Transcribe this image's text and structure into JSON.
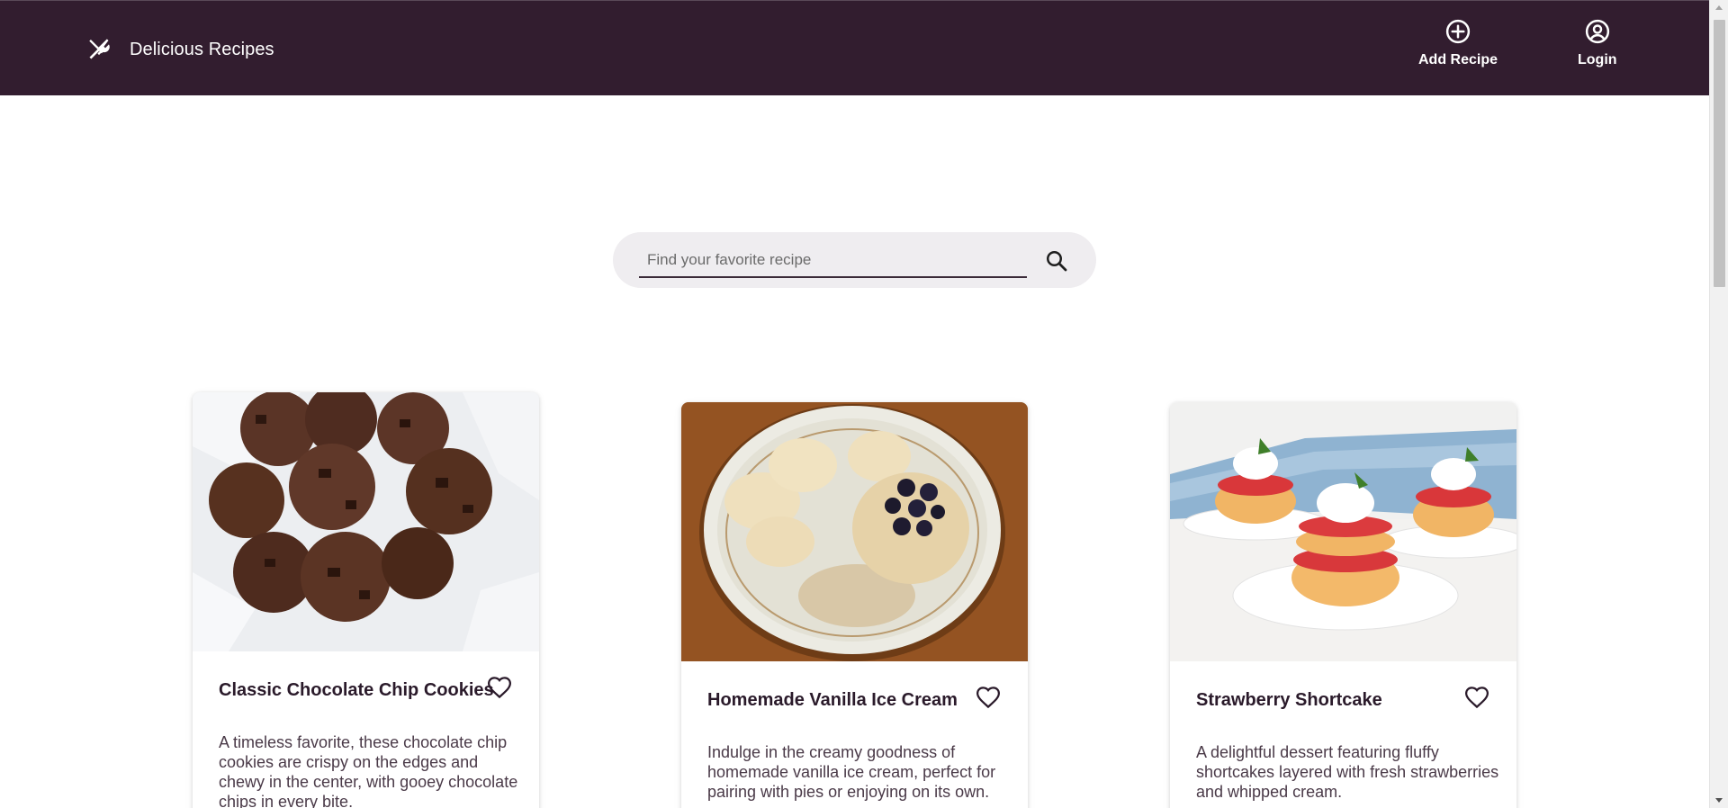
{
  "header": {
    "title": "Delicious Recipes",
    "actions": [
      {
        "label": "Add Recipe",
        "icon": "add-circle-icon"
      },
      {
        "label": "Login",
        "icon": "account-circle-icon"
      }
    ]
  },
  "search": {
    "placeholder": "Find your favorite recipe",
    "value": ""
  },
  "recipes": [
    {
      "title": "Classic Chocolate Chip Cookies",
      "description": "A timeless favorite, these chocolate chip cookies are crispy on the edges and chewy in the center, with gooey chocolate chips in every bite."
    },
    {
      "title": "Homemade Vanilla Ice Cream",
      "description": "Indulge in the creamy goodness of homemade vanilla ice cream, perfect for pairing with pies or enjoying on its own."
    },
    {
      "title": "Strawberry Shortcake",
      "description": "A delightful dessert featuring fluffy shortcakes layered with fresh strawberries and whipped cream."
    }
  ],
  "colors": {
    "header_bg": "#321d2f",
    "search_bg": "#efedf0",
    "accent_text": "#2a1a2a"
  }
}
